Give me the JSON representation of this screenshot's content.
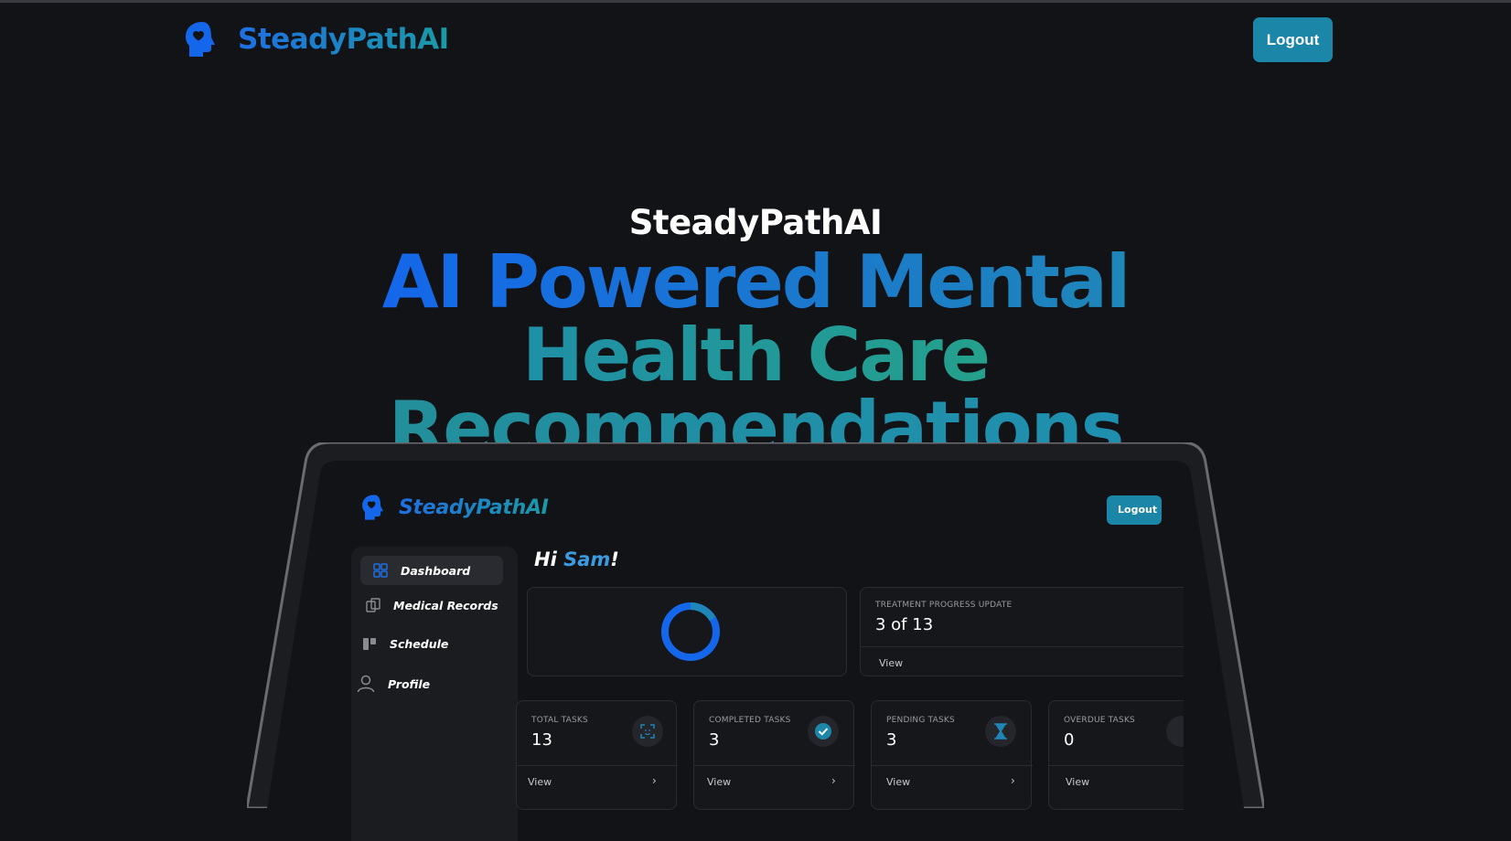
{
  "header": {
    "brand_name": "SteadyPathAI",
    "logout_label": "Logout"
  },
  "hero": {
    "eyebrow": "SteadyPathAI",
    "title_line1": "AI Powered Mental",
    "title_line2": "Health Care",
    "title_line3": "Recommendations"
  },
  "mockup": {
    "brand_name": "SteadyPathAI",
    "logout_label": "Logout",
    "greeting_prefix": "Hi ",
    "greeting_name": "Sam",
    "greeting_suffix": "!",
    "sidebar": [
      {
        "label": "Dashboard",
        "icon": "dashboard-icon",
        "active": true
      },
      {
        "label": "Medical Records",
        "icon": "records-icon",
        "active": false
      },
      {
        "label": "Schedule",
        "icon": "schedule-icon",
        "active": false
      },
      {
        "label": "Profile",
        "icon": "profile-icon",
        "active": false
      }
    ],
    "progress_card": {
      "label": "TREATMENT PROGRESS UPDATE",
      "value": "3 of 13",
      "link": "View"
    },
    "stats": [
      {
        "label": "TOTAL TASKS",
        "value": "13",
        "link": "View",
        "icon": "scan-face-icon"
      },
      {
        "label": "COMPLETED TASKS",
        "value": "3",
        "link": "View",
        "icon": "check-circle-icon"
      },
      {
        "label": "PENDING TASKS",
        "value": "3",
        "link": "View",
        "icon": "hourglass-icon"
      },
      {
        "label": "OVERDUE TASKS",
        "value": "0",
        "link": "View",
        "icon": "alert-icon"
      }
    ],
    "colors": {
      "accent_blue": "#1467ea",
      "accent_teal": "#1b86a8"
    }
  }
}
